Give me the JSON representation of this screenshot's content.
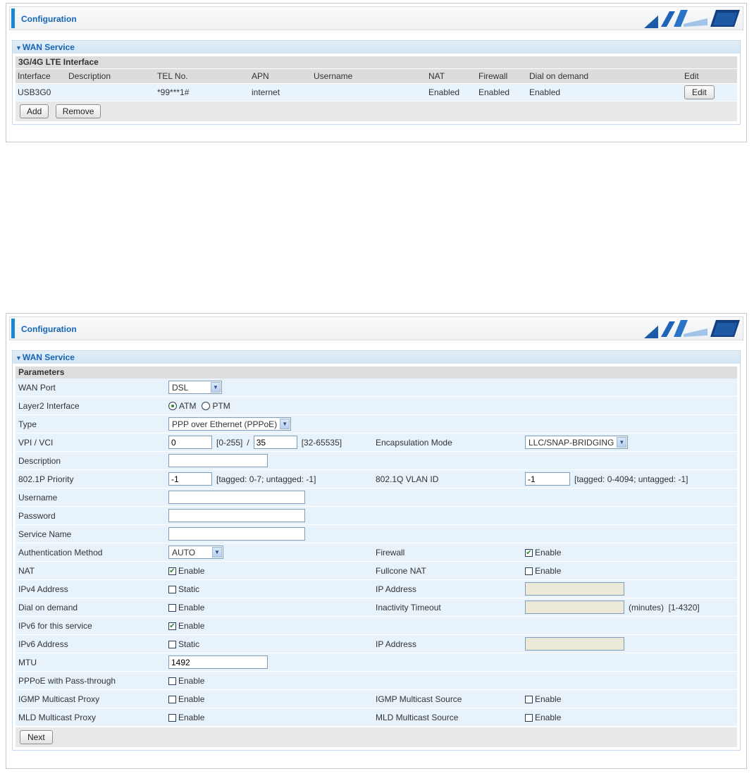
{
  "colors": {
    "accent": "#1c86d6",
    "title_blue": "#1565b5",
    "row_bg": "#e7f2fb",
    "header_bg": "#dcdcdc"
  },
  "top": {
    "header_title": "Configuration",
    "wan_title": "WAN Service",
    "section_title": "3G/4G LTE Interface",
    "columns": [
      "Interface",
      "Description",
      "TEL No.",
      "APN",
      "Username",
      "NAT",
      "Firewall",
      "Dial on demand",
      "Edit"
    ],
    "rows": [
      {
        "interface": "USB3G0",
        "description": "",
        "tel": "*99***1#",
        "apn": "internet",
        "username": "",
        "nat": "Enabled",
        "firewall": "Enabled",
        "dial": "Enabled",
        "edit_label": "Edit"
      }
    ],
    "add_label": "Add",
    "remove_label": "Remove"
  },
  "bottom": {
    "header_title": "Configuration",
    "wan_title": "WAN Service",
    "section_title": "Parameters",
    "wan_port": {
      "label": "WAN Port",
      "value": "DSL"
    },
    "layer2": {
      "label": "Layer2 Interface",
      "opt_atm": "ATM",
      "opt_ptm": "PTM",
      "selected": "ATM"
    },
    "type": {
      "label": "Type",
      "value": "PPP over Ethernet (PPPoE)"
    },
    "vpivci": {
      "label": "VPI / VCI",
      "vpi": "0",
      "vpi_range": "[0-255]",
      "sep": "/",
      "vci": "35",
      "vci_range": "[32-65535]"
    },
    "encap": {
      "label": "Encapsulation Mode",
      "value": "LLC/SNAP-BRIDGING"
    },
    "description": {
      "label": "Description",
      "value": ""
    },
    "priority": {
      "label": "802.1P Priority",
      "value": "-1",
      "hint": "[tagged: 0-7; untagged: -1]"
    },
    "vlan": {
      "label": "802.1Q VLAN ID",
      "value": "-1",
      "hint": "[tagged: 0-4094; untagged: -1]"
    },
    "username": {
      "label": "Username",
      "value": ""
    },
    "password": {
      "label": "Password",
      "value": ""
    },
    "service_name": {
      "label": "Service Name",
      "value": ""
    },
    "auth": {
      "label": "Authentication Method",
      "value": "AUTO"
    },
    "firewall": {
      "label": "Firewall",
      "text": "Enable",
      "checked": true
    },
    "nat": {
      "label": "NAT",
      "text": "Enable",
      "checked": true
    },
    "fullcone": {
      "label": "Fullcone NAT",
      "text": "Enable",
      "checked": false
    },
    "ipv4": {
      "label": "IPv4 Address",
      "text": "Static",
      "checked": false
    },
    "ipv4_addr": {
      "label": "IP Address",
      "value": ""
    },
    "dial": {
      "label": "Dial on demand",
      "text": "Enable",
      "checked": false
    },
    "inactivity": {
      "label": "Inactivity Timeout",
      "value": "",
      "hint": "(minutes)  [1-4320]"
    },
    "ipv6_service": {
      "label": "IPv6 for this service",
      "text": "Enable",
      "checked": true
    },
    "ipv6": {
      "label": "IPv6 Address",
      "text": "Static",
      "checked": false
    },
    "ipv6_addr": {
      "label": "IP Address",
      "value": ""
    },
    "mtu": {
      "label": "MTU",
      "value": "1492"
    },
    "pppoe_pass": {
      "label": "PPPoE with Pass-through",
      "text": "Enable",
      "checked": false
    },
    "igmp_proxy": {
      "label": "IGMP Multicast Proxy",
      "text": "Enable",
      "checked": false
    },
    "igmp_source": {
      "label": "IGMP Multicast Source",
      "text": "Enable",
      "checked": false
    },
    "mld_proxy": {
      "label": "MLD Multicast Proxy",
      "text": "Enable",
      "checked": false
    },
    "mld_source": {
      "label": "MLD Multicast Source",
      "text": "Enable",
      "checked": false
    },
    "next_label": "Next"
  }
}
